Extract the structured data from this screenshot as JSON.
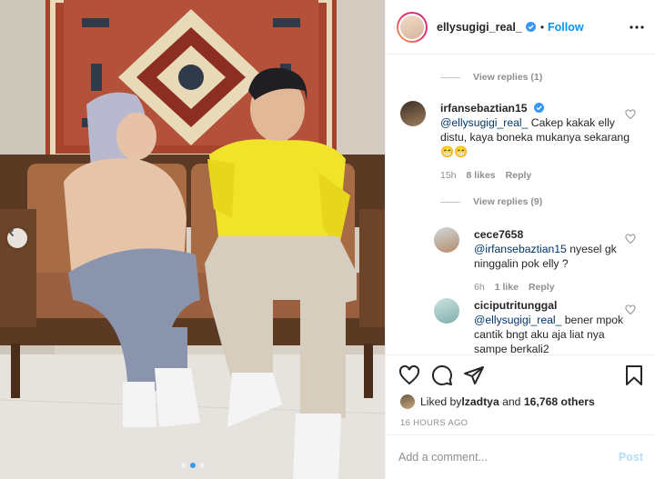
{
  "header": {
    "username": "ellysugigi_real_",
    "separator": "•",
    "follow_label": "Follow"
  },
  "comments": [
    {
      "view_replies_above": "View replies (1)",
      "username": "irfansebaztian15",
      "verified": true,
      "mention": "@ellysugigi_real_",
      "text": " Cakep kakak elly distu, kaya boneka mukanya sekarang 😁😁",
      "time": "15h",
      "likes": "8 likes",
      "reply_label": "Reply",
      "view_replies_below": "View replies (9)"
    },
    {
      "username": "cece7658",
      "mention": "@irfansebaztian15",
      "text": " nyesel gk ninggalin pok elly ?",
      "time": "6h",
      "likes": "1 like",
      "reply_label": "Reply"
    },
    {
      "username": "ciciputritunggal",
      "mention": "@ellysugigi_real_",
      "text": " bener mpok cantik bngt aku aja liat nya sampe berkali2"
    }
  ],
  "likes": {
    "prefix": "Liked by ",
    "user": "lzadtya",
    "middle": " and ",
    "count": "16,768 others"
  },
  "timestamp": "16 HOURS AGO",
  "add_comment": {
    "placeholder": "Add a comment...",
    "post_label": "Post"
  },
  "carousel": {
    "slide_count": 3,
    "active_index": 1
  },
  "colors": {
    "link_blue": "#0095f6",
    "mention_blue": "#00376b",
    "muted": "#8e8e8e",
    "shirt_yellow": "#f1e32a"
  },
  "icons": [
    "chevron-left-icon",
    "more-icon",
    "verified-icon",
    "heart-icon",
    "comment-icon",
    "share-icon",
    "bookmark-icon"
  ]
}
